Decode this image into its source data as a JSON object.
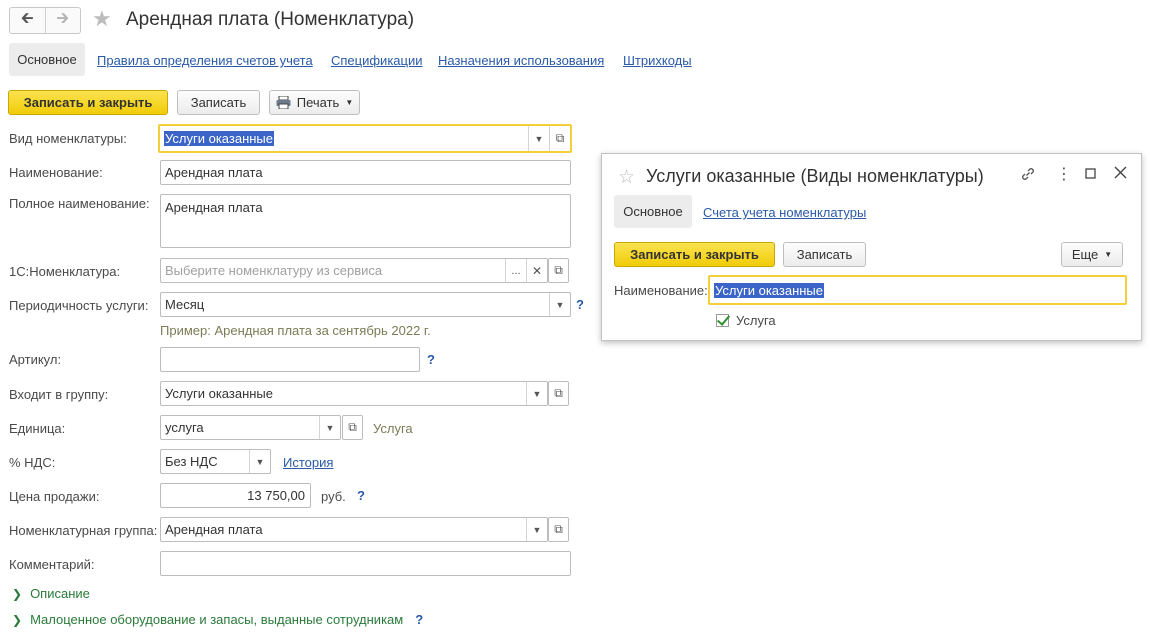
{
  "header": {
    "back_icon": "arrow-left",
    "forward_icon": "arrow-right",
    "title": "Арендная плата (Номенклатура)"
  },
  "tabs": {
    "active": "Основное",
    "links": [
      "Правила определения счетов учета",
      "Спецификации",
      "Назначения использования",
      "Штрихкоды"
    ]
  },
  "toolbar": {
    "save_close": "Записать и закрыть",
    "save": "Записать",
    "print": "Печать"
  },
  "form": {
    "kind_label": "Вид номенклатуры:",
    "kind_value": "Услуги оказанные",
    "name_label": "Наименование:",
    "name_value": "Арендная плата",
    "fullname_label": "Полное наименование:",
    "fullname_value": "Арендная плата",
    "onec_label": "1С:Номенклатура:",
    "onec_placeholder": "Выберите номенклатуру из сервиса",
    "period_label": "Периодичность услуги:",
    "period_value": "Месяц",
    "period_hint": "Пример: Арендная плата за сентябрь 2022 г.",
    "article_label": "Артикул:",
    "article_value": "",
    "group_label": "Входит в группу:",
    "group_value": "Услуги оказанные",
    "unit_label": "Единица:",
    "unit_value": "услуга",
    "unit_hint": "Услуга",
    "vat_label": "% НДС:",
    "vat_value": "Без НДС",
    "vat_history": "История",
    "price_label": "Цена продажи:",
    "price_value": "13 750,00",
    "price_unit": "руб.",
    "nomgroup_label": "Номенклатурная группа:",
    "nomgroup_value": "Арендная плата",
    "comment_label": "Комментарий:",
    "comment_value": "",
    "question_mark": "?"
  },
  "sections": {
    "description": "Описание",
    "equipment": "Малоценное оборудование и запасы, выданные сотрудникам"
  },
  "popup": {
    "title": "Услуги оказанные (Виды номенклатуры)",
    "tab_active": "Основное",
    "tab_link": "Счета учета номенклатуры",
    "save_close": "Записать и закрыть",
    "save": "Записать",
    "more": "Еще",
    "name_label": "Наименование:",
    "name_value": "Услуги оказанные",
    "service_checkbox": "Услуга",
    "service_checked": true
  }
}
